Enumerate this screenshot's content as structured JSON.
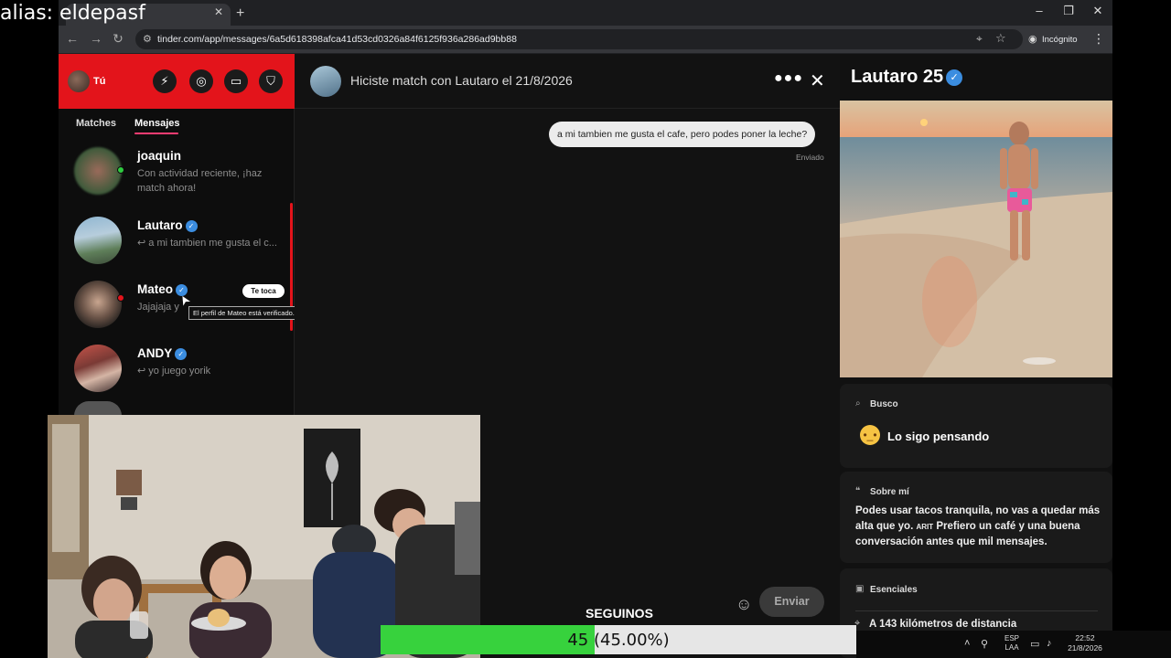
{
  "stream": {
    "alias": "alias: eldepasf"
  },
  "browser": {
    "url": "tinder.com/app/messages/6a5d618398afca41d53cd0326a84f6125f936a286ad9bb88",
    "incognito_label": "Incógnito",
    "window_buttons": [
      "–",
      "❐",
      "✕"
    ]
  },
  "sidebar": {
    "me_label": "Tú",
    "header_icons": [
      "bolt-icon",
      "compass-icon",
      "briefcase-icon",
      "shield-icon"
    ],
    "tabs": [
      {
        "label": "Matches"
      },
      {
        "label": "Mensajes"
      }
    ],
    "conversations": [
      {
        "name": "joaquin",
        "preview": "Con actividad reciente, ¡haz match ahora!",
        "verified": false
      },
      {
        "name": "Lautaro",
        "preview": "↩ a mi tambien me gusta el c...",
        "verified": true
      },
      {
        "name": "Mateo",
        "preview": "Jajajaja y",
        "verified": true,
        "badge": "Te toca"
      },
      {
        "name": "ANDY",
        "preview": "↩ yo juego yorik",
        "verified": true
      }
    ],
    "tooltip": "El perfil de Mateo está verificado."
  },
  "chat": {
    "title": "Hiciste match con Lautaro el 21/8/2026",
    "message": "a mi tambien me gusta el cafe, pero podes poner la leche?",
    "status": "Enviado",
    "send_label": "Enviar"
  },
  "profile": {
    "name_age": "Lautaro 25",
    "looking_title": "Busco",
    "looking_value": "Lo sigo pensando",
    "about_title": "Sobre mí",
    "about_text_1": "Podes usar tacos tranquila, no vas a quedar más alta que yo.",
    "about_small": "ARIT",
    "about_text_2": "Prefiero un café y una buena conversación antes que mil mensajes.",
    "essentials_title": "Esenciales",
    "distance": "A 143 kilómetros de distancia"
  },
  "overlay": {
    "goal_label": "SEGUINOS",
    "progress_value": 45,
    "progress_percent": 0.45,
    "progress_text": "45 (45.00%)"
  },
  "taskbar": {
    "lang_1": "ESP",
    "lang_2": "LAA",
    "time": "22:52",
    "date": "21/8/2026"
  },
  "colors": {
    "tinder_red": "#e3141b",
    "tinder_pink": "#fe3c72",
    "verified_blue": "#3b8de0",
    "progress_green": "#37d23d",
    "online_green": "#2ecc40",
    "alert_red": "#e3141b"
  }
}
